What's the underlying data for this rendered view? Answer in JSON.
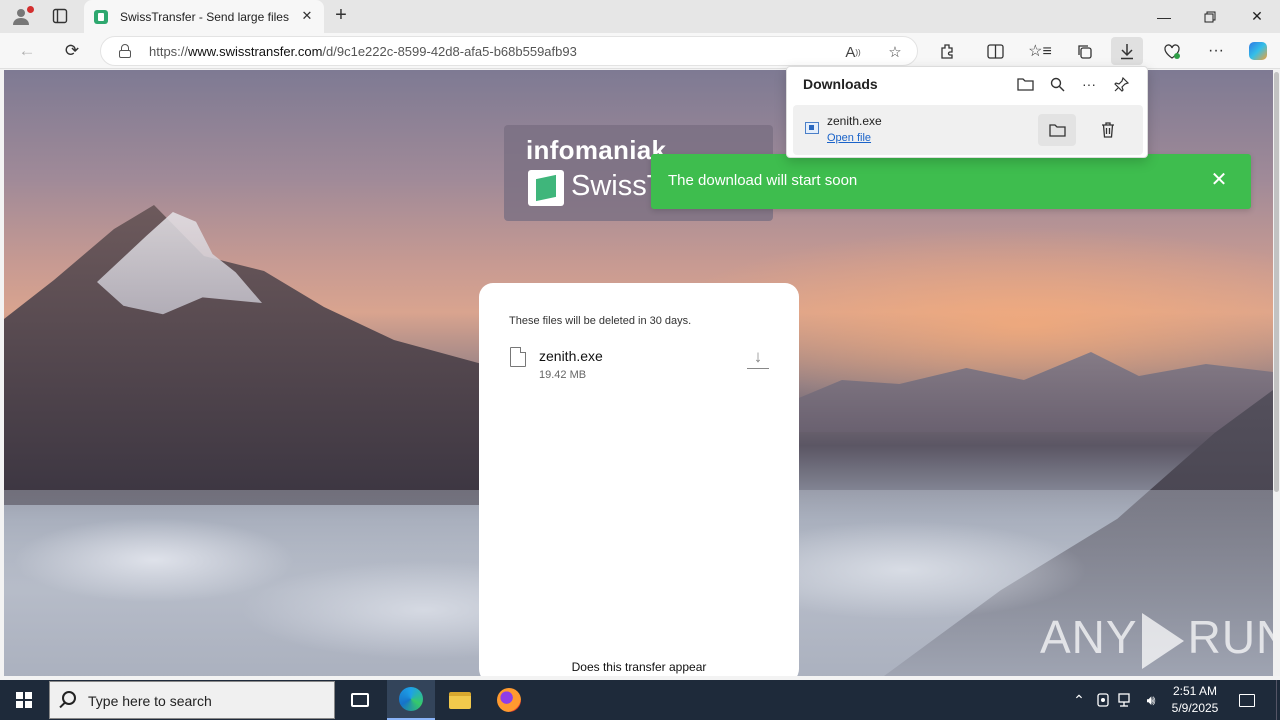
{
  "browser": {
    "tab": {
      "title": "SwissTransfer - Send large files se"
    },
    "address": {
      "url_prefix": "https://",
      "url_host": "www.swisstransfer.com",
      "url_path": "/d/9c1e222c-8599-42d8-afa5-b68b559afb93"
    }
  },
  "downloads_panel": {
    "title": "Downloads",
    "item": {
      "file_name": "zenith.exe",
      "open_label": "Open file"
    }
  },
  "page": {
    "brand": {
      "company": "infomaniak",
      "product": "SwissTransfer"
    },
    "toast": {
      "message": "The download will start soon"
    },
    "card": {
      "deletion_note": "These files will be deleted in 30 days.",
      "file_name": "zenith.exe",
      "file_size": "19.42 MB",
      "footer": "Does this transfer appear"
    },
    "watermark": {
      "left": "ANY",
      "right": "RUN"
    }
  },
  "taskbar": {
    "search_placeholder": "Type here to search",
    "time": "2:51 AM",
    "date": "5/9/2025"
  },
  "colors": {
    "toast_bg": "#3ebd4e",
    "link": "#1a63c9",
    "taskbar_bg": "#1e2a3a"
  }
}
